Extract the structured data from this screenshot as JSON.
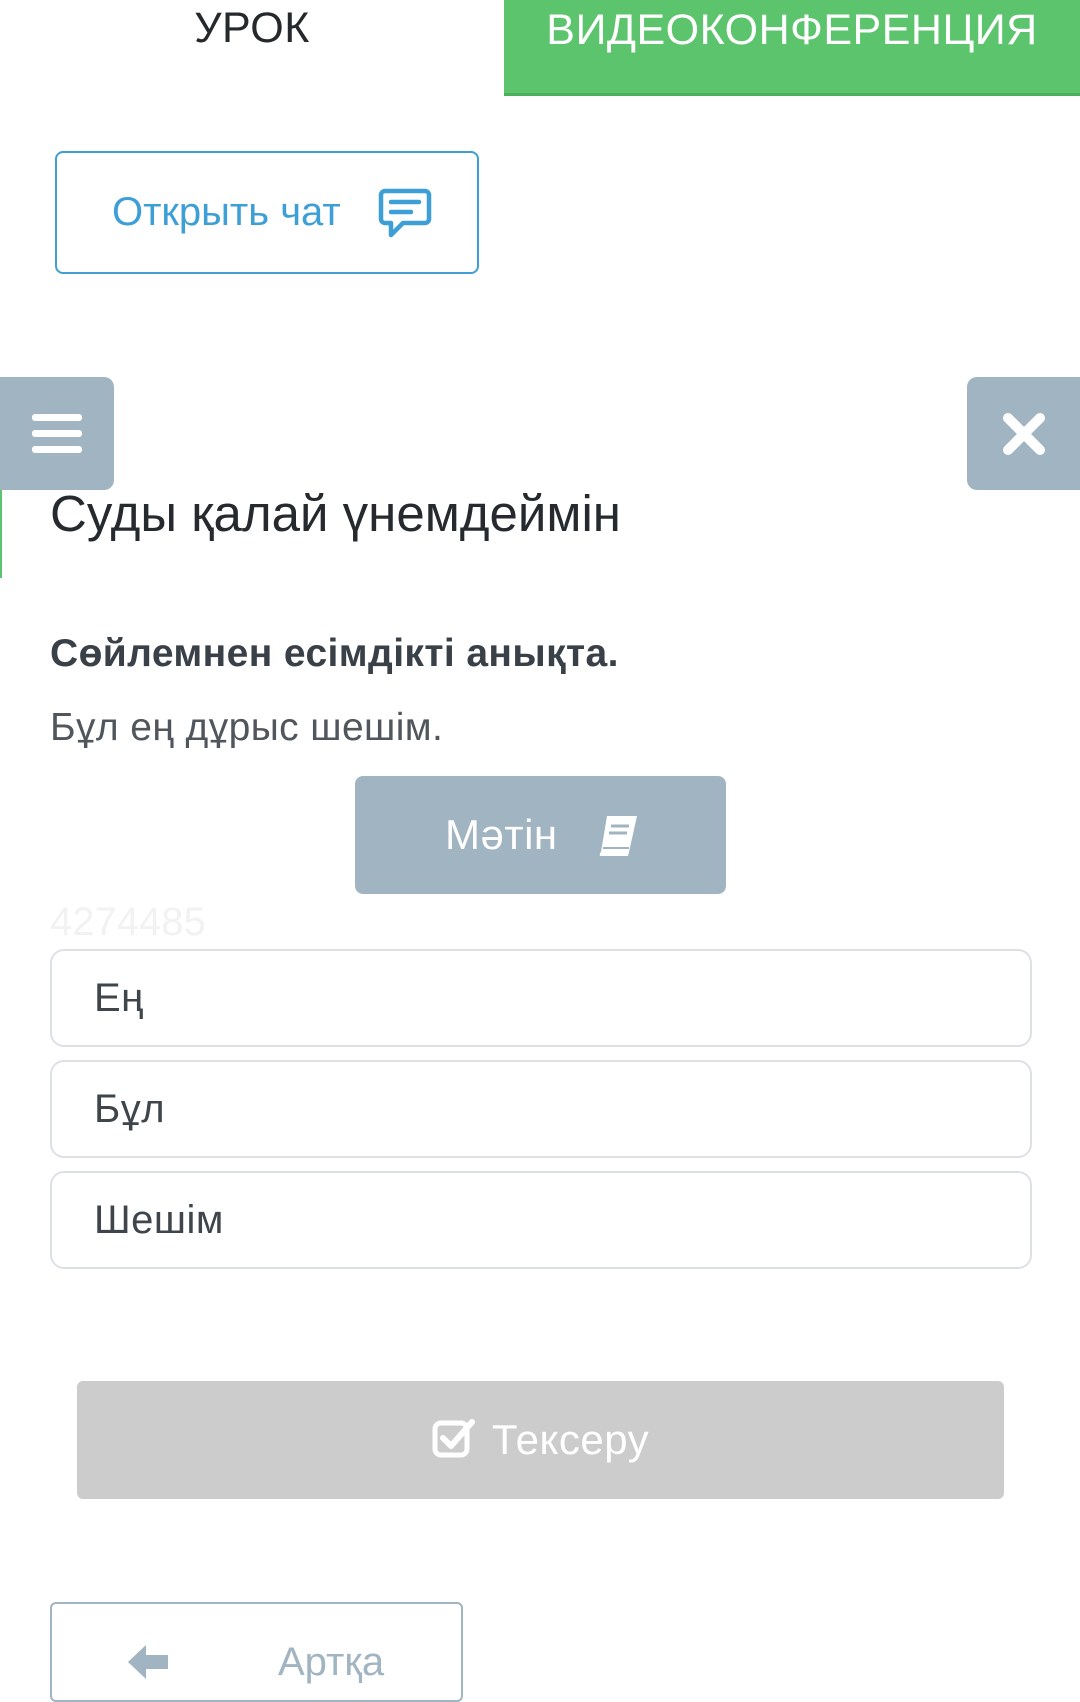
{
  "tabs": {
    "lesson": "УРОК",
    "videoconference": "ВИДЕОКОНФЕРЕНЦИЯ"
  },
  "chat": {
    "open_label": "Открыть чат",
    "icon": "chat-bubble-icon"
  },
  "controls": {
    "menu_icon": "hamburger-menu-icon",
    "close_icon": "close-icon"
  },
  "lesson": {
    "title": "Суды қалай үнемдеймін"
  },
  "task": {
    "question": "Сөйлемнен есімдікті анықта.",
    "sentence": "Бұл ең дұрыс шешім.",
    "text_button_label": "Мәтін",
    "text_button_icon": "book-icon",
    "watermark": "4274485",
    "options": [
      {
        "label": "Ең"
      },
      {
        "label": "Бұл"
      },
      {
        "label": "Шешім"
      }
    ]
  },
  "actions": {
    "check_label": "Тексеру",
    "check_icon": "checkbox-icon",
    "back_label": "Артқа",
    "back_icon": "arrow-left-icon"
  },
  "colors": {
    "accent_green": "#5cc46c",
    "link_blue": "#3d9fd6",
    "control_gray_blue": "#a1b4c1",
    "disabled_gray": "#cccccc"
  }
}
